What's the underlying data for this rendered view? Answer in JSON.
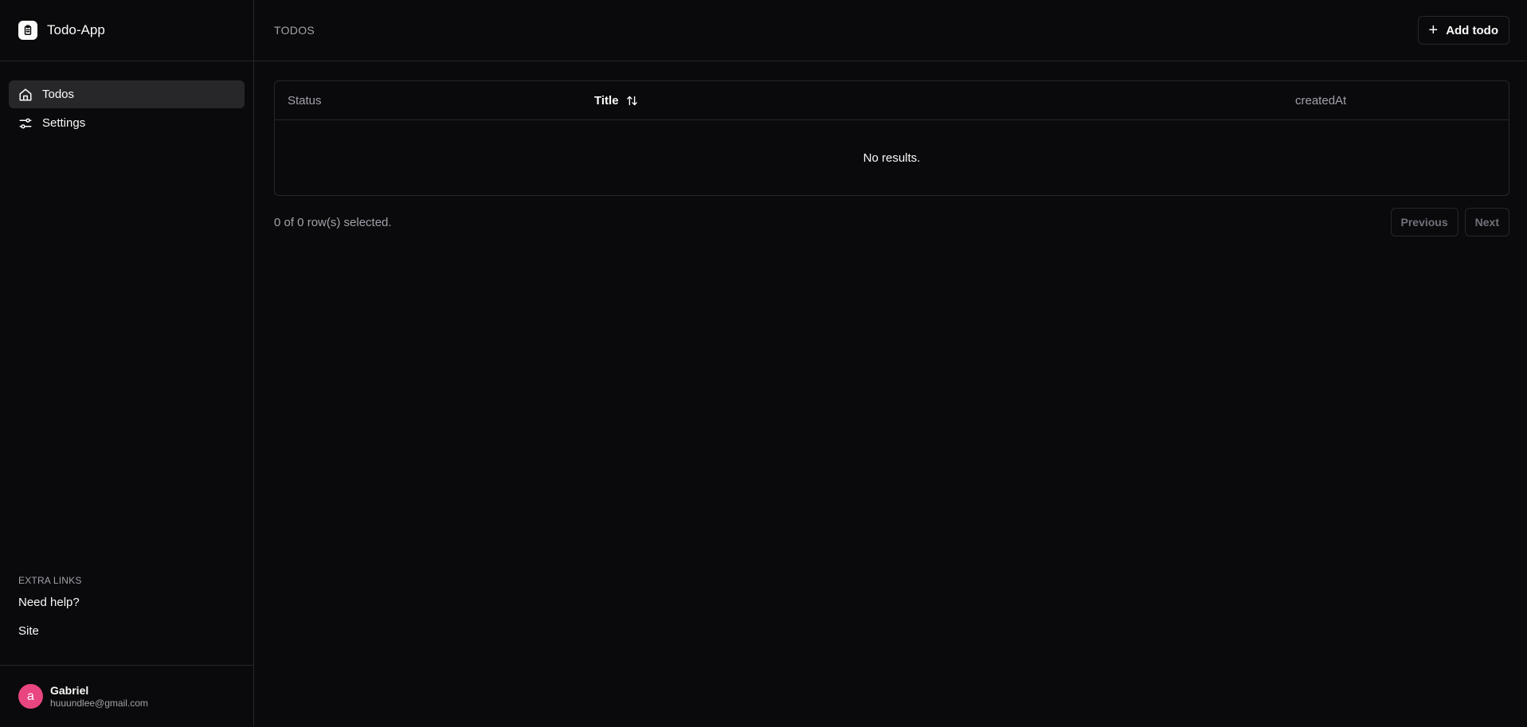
{
  "app": {
    "title": "Todo-App"
  },
  "sidebar": {
    "items": [
      {
        "label": "Todos",
        "icon": "home-icon",
        "active": true
      },
      {
        "label": "Settings",
        "icon": "sliders-icon",
        "active": false
      }
    ],
    "extra": {
      "title": "EXTRA LINKS",
      "links": [
        "Need help?",
        "Site"
      ]
    },
    "user": {
      "initial": "a",
      "name": "Gabriel",
      "email": "huuundlee@gmail.com",
      "avatar_color": "#e94580"
    }
  },
  "header": {
    "breadcrumb": "TODOS",
    "add_label": "Add todo"
  },
  "table": {
    "columns": [
      "Status",
      "Title",
      "createdAt"
    ],
    "empty_text": "No results."
  },
  "pagination": {
    "selected_text": "0 of 0 row(s) selected.",
    "previous_label": "Previous",
    "next_label": "Next"
  }
}
